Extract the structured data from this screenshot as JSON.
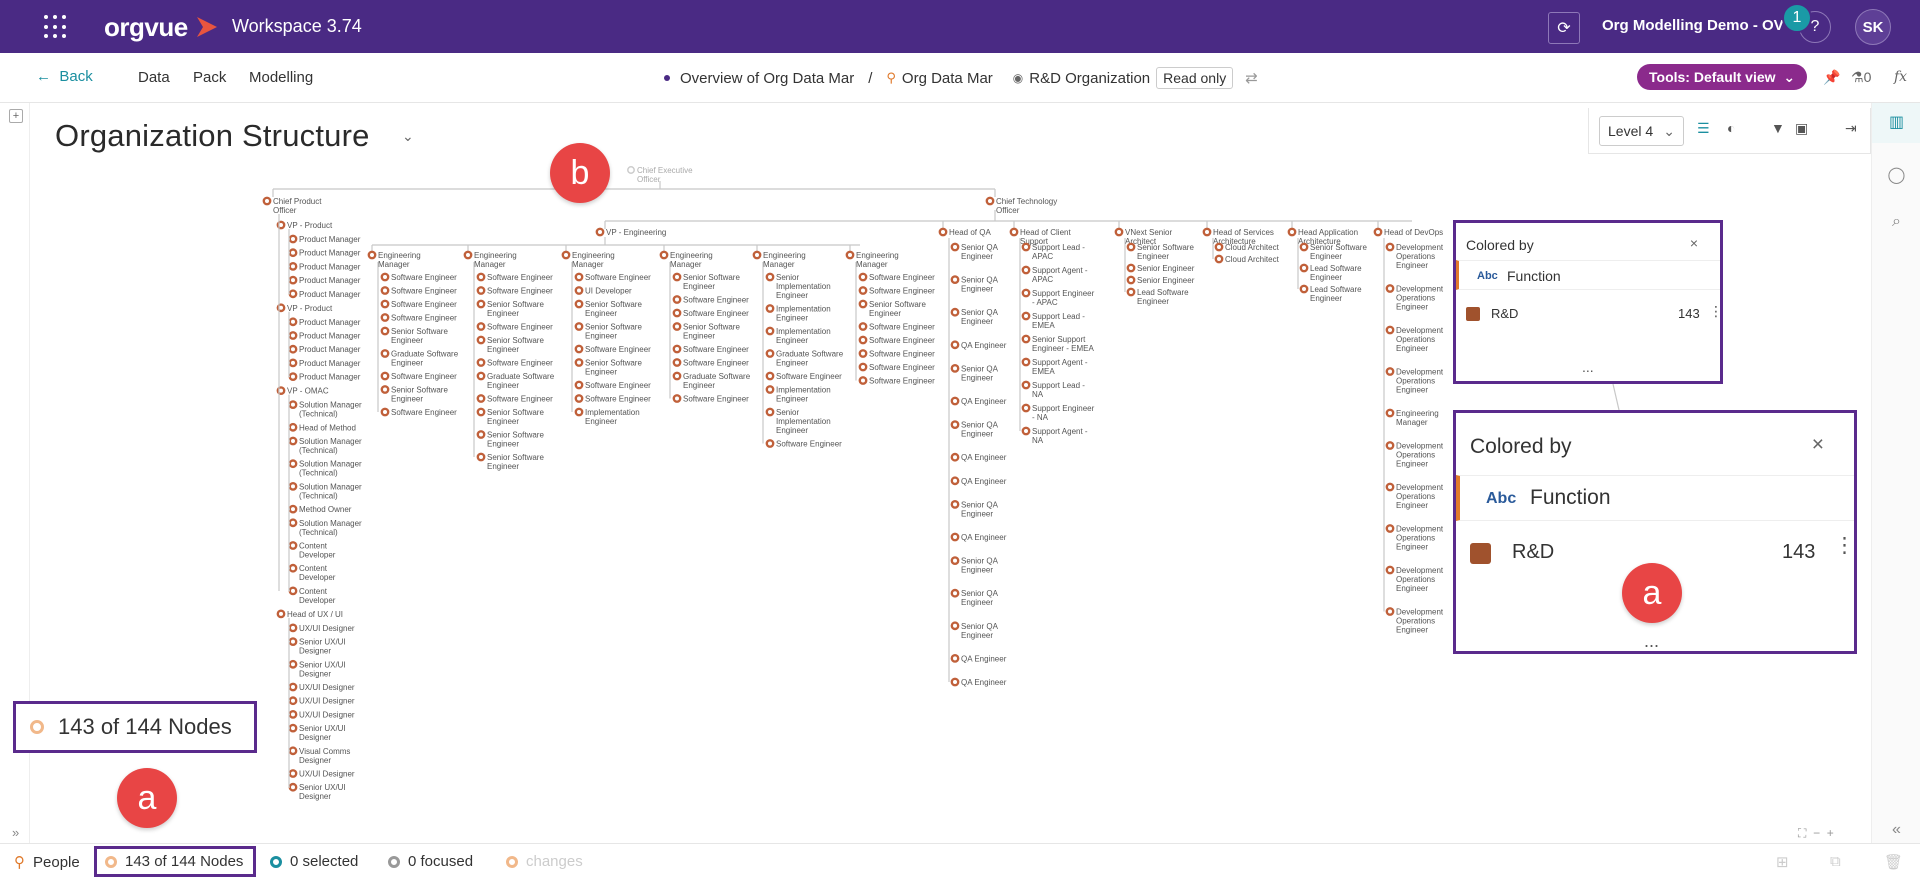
{
  "topbar": {
    "logo": "orgvue",
    "workspace_title": "Workspace 3.74",
    "demo_title": "Org Modelling Demo - OV",
    "notification_count": "1",
    "help_label": "?",
    "user_initials": "SK"
  },
  "subbar": {
    "back_label": "Back",
    "nav": [
      "Data",
      "Pack",
      "Modelling"
    ],
    "breadcrumb": [
      "Overview of Org Data Mar",
      "/",
      "Org Data Mar",
      "R&D Organization"
    ],
    "readonly_label": "Read only",
    "tools_label": "Tools: Default view",
    "flask_count": "0",
    "fx_label": "fx"
  },
  "page": {
    "title": "Organization Structure",
    "level_label": "Level 4"
  },
  "legend": {
    "heading": "Colored by",
    "type_tag": "Abc",
    "field": "Function",
    "item_label": "R&D",
    "item_count": "143",
    "item_color": "#a0522d",
    "more": "..."
  },
  "markers": {
    "a": "a",
    "b": "b"
  },
  "callout": {
    "nodes_text": "143 of 144 Nodes"
  },
  "statusbar": {
    "people": "People",
    "nodes": "143 of 144 Nodes",
    "selected": "0 selected",
    "focused": "0 focused",
    "changes": "changes"
  },
  "chart": {
    "ceo": "Chief Executive Officer",
    "cpo": "Chief Product Officer",
    "cto": "Chief Technology Officer",
    "vp_eng": "VP - Engineering",
    "cpo_tree": [
      {
        "label": "VP - Product",
        "children": [
          "Product Manager",
          "Product Manager",
          "Product Manager",
          "Product Manager",
          "Product Manager"
        ]
      },
      {
        "label": "VP - Product",
        "children": [
          "Product Manager",
          "Product Manager",
          "Product Manager",
          "Product Manager",
          "Product Manager"
        ]
      },
      {
        "label": "VP - OMAC",
        "children": [
          "Solution Manager (Technical)",
          "Head of Method",
          "Solution Manager (Technical)",
          "Solution Manager (Technical)",
          "Solution Manager (Technical)",
          "Method Owner",
          "Solution Manager (Technical)",
          "Content Developer",
          "Content Developer",
          "Content Developer"
        ]
      },
      {
        "label": "Head of UX / UI",
        "children": [
          "UX/UI Designer",
          "Senior UX/UI Designer",
          "Senior UX/UI Designer",
          "UX/UI Designer",
          "UX/UI Designer",
          "UX/UI Designer",
          "Senior UX/UI Designer",
          "Visual Comms Designer",
          "UX/UI Designer",
          "Senior UX/UI Designer"
        ]
      }
    ],
    "eng_managers": [
      {
        "label": "Engineering Manager",
        "children": [
          "Software Engineer",
          "Software Engineer",
          "Software Engineer",
          "Software Engineer",
          "Senior Software Engineer",
          "Graduate Software Engineer",
          "Software Engineer",
          "Senior Software Engineer",
          "Software Engineer"
        ]
      },
      {
        "label": "Engineering Manager",
        "children": [
          "Software Engineer",
          "Software Engineer",
          "Senior Software Engineer",
          "Software Engineer",
          "Senior Software Engineer",
          "Software Engineer",
          "Graduate Software Engineer",
          "Software Engineer",
          "Senior Software Engineer",
          "Senior Software Engineer",
          "Senior Software Engineer"
        ]
      },
      {
        "label": "Engineering Manager",
        "children": [
          "Software Engineer",
          "UI Developer",
          "Senior Software Engineer",
          "Senior Software Engineer",
          "Software Engineer",
          "Senior Software Engineer",
          "Software Engineer",
          "Software Engineer",
          "Implementation Engineer"
        ]
      },
      {
        "label": "Engineering Manager",
        "children": [
          "Senior Software Engineer",
          "Software Engineer",
          "Software Engineer",
          "Senior Software Engineer",
          "Software Engineer",
          "Software Engineer",
          "Graduate Software Engineer",
          "Software Engineer"
        ]
      },
      {
        "label": "Engineering Manager",
        "children": [
          "Senior Implementation Engineer",
          "Implementation Engineer",
          "Implementation Engineer",
          "Graduate Software Engineer",
          "Software Engineer",
          "Implementation Engineer",
          "Senior Implementation Engineer",
          "Software Engineer"
        ]
      },
      {
        "label": "Engineering Manager",
        "children": [
          "Software Engineer",
          "Software Engineer",
          "Senior Software Engineer",
          "Software Engineer",
          "Software Engineer",
          "Software Engineer",
          "Software Engineer",
          "Software Engineer"
        ]
      }
    ],
    "cto_tree": [
      {
        "label": "Head of QA",
        "children": [
          "Senior QA Engineer",
          "Senior QA Engineer",
          "Senior QA Engineer",
          "QA Engineer",
          "Senior QA Engineer",
          "QA Engineer",
          "Senior QA Engineer",
          "QA Engineer",
          "QA Engineer",
          "Senior QA Engineer",
          "QA Engineer",
          "Senior QA Engineer",
          "Senior QA Engineer",
          "Senior QA Engineer",
          "QA Engineer",
          "QA Engineer"
        ]
      },
      {
        "label": "Head of Client Support",
        "children": [
          "Support Lead - APAC",
          "Support Agent - APAC",
          "Support Engineer - APAC",
          "Support Lead - EMEA",
          "Senior Support Engineer - EMEA",
          "Support Agent - EMEA",
          "Support Lead - NA",
          "Support Engineer - NA",
          "Support Agent - NA"
        ]
      },
      {
        "label": "VNext Senior Architect",
        "children": [
          "Senior Software Engineer",
          "Senior Engineer",
          "Senior Engineer",
          "Lead Software Engineer"
        ]
      },
      {
        "label": "Head of Services Architecture",
        "children": [
          "Cloud Architect",
          "Cloud Architect"
        ]
      },
      {
        "label": "Head Application Architecture",
        "children": [
          "Senior Software Engineer",
          "Lead Software Engineer",
          "Lead Software Engineer"
        ]
      },
      {
        "label": "Head of DevOps",
        "children": [
          "Development Operations Engineer",
          "Development Operations Engineer",
          "Development Operations Engineer",
          "Development Operations Engineer",
          "Engineering Manager",
          "Development Operations Engineer",
          "Development Operations Engineer",
          "Development Operations Engineer",
          "Development Operations Engineer",
          "Development Operations Engineer"
        ]
      }
    ]
  }
}
